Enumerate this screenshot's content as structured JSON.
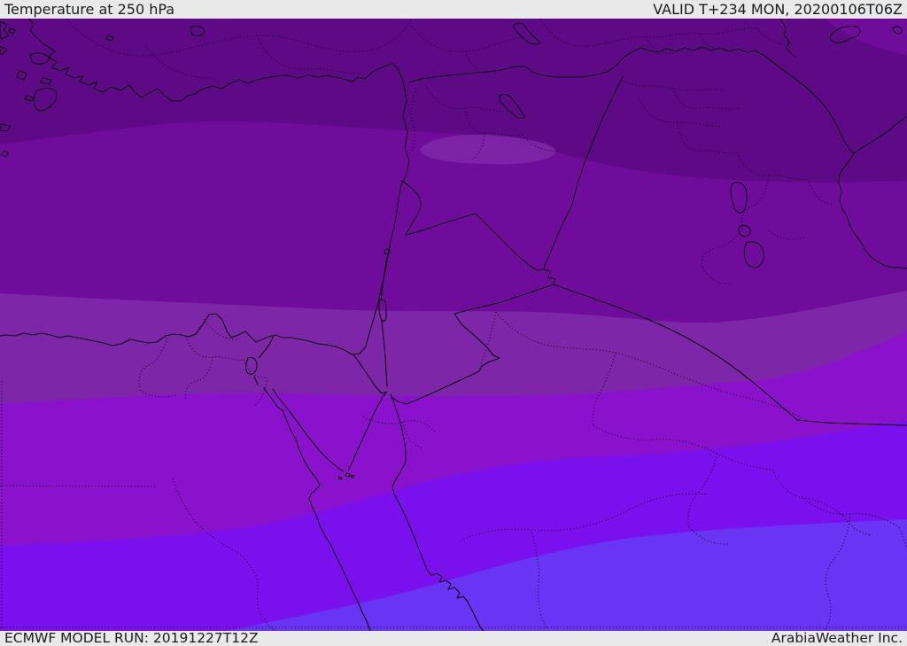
{
  "header": {
    "title": "Temperature at 250 hPa",
    "valid_time": "VALID T+234 MON, 20200106T06Z"
  },
  "footer": {
    "model_run": "ECMWF MODEL RUN: 20191227T12Z",
    "brand": "ArabiaWeather Inc."
  },
  "chrome": {
    "bar_background": "#e9e9e9",
    "bar_text_color": "#1c1c1c"
  },
  "map": {
    "parameter": "Temperature",
    "pressure_level": "250 hPa",
    "model": "ECMWF",
    "line_colors": {
      "coastline_border": "#0a0a0a",
      "admin_boundary": "#0a0a0a"
    },
    "bands": [
      {
        "name": "band-1-north-darkest",
        "color": "#5e0a87"
      },
      {
        "name": "band-2",
        "color": "#6f0c9c"
      },
      {
        "name": "band-3",
        "color": "#7d26a7"
      },
      {
        "name": "band-4",
        "color": "#8b12cc"
      },
      {
        "name": "band-5",
        "color": "#7b10ee"
      },
      {
        "name": "band-6-south-blue",
        "color": "#6934f4"
      }
    ]
  }
}
